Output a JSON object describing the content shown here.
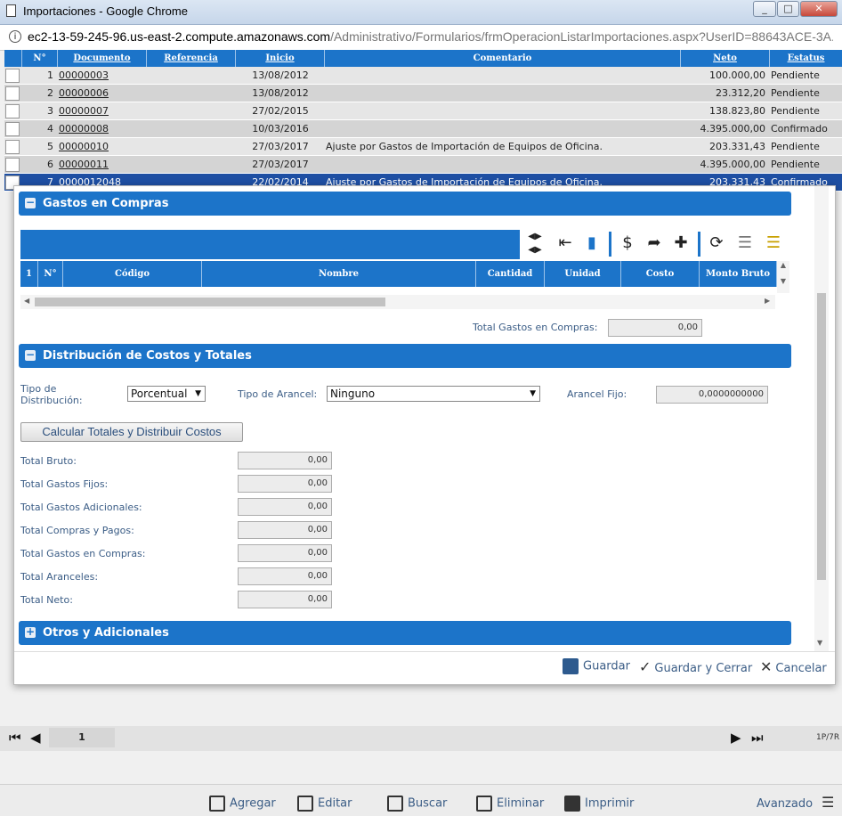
{
  "window": {
    "title": "Importaciones - Google Chrome",
    "min": "_",
    "max": "□",
    "close": "✕"
  },
  "address": {
    "host": "ec2-13-59-245-96.us-east-2.compute.amazonaws.com",
    "path": "/Administrativo/Formularios/frmOperacionListarImportaciones.aspx?UserID=88643ACE-3A..."
  },
  "grid": {
    "headers": {
      "num": "N°",
      "documento": "Documento",
      "referencia": "Referencia",
      "inicio": "Inicio",
      "comentario": "Comentario",
      "neto": "Neto",
      "estatus": "Estatus"
    },
    "rows": [
      {
        "n": "1",
        "doc": "00000003",
        "ref": "",
        "inicio": "13/08/2012",
        "comentario": "",
        "neto": "100.000,00",
        "estatus": "Pendiente"
      },
      {
        "n": "2",
        "doc": "00000006",
        "ref": "",
        "inicio": "13/08/2012",
        "comentario": "",
        "neto": "23.312,20",
        "estatus": "Pendiente"
      },
      {
        "n": "3",
        "doc": "00000007",
        "ref": "",
        "inicio": "27/02/2015",
        "comentario": "",
        "neto": "138.823,80",
        "estatus": "Pendiente"
      },
      {
        "n": "4",
        "doc": "00000008",
        "ref": "",
        "inicio": "10/03/2016",
        "comentario": "",
        "neto": "4.395.000,00",
        "estatus": "Confirmado"
      },
      {
        "n": "5",
        "doc": "00000010",
        "ref": "",
        "inicio": "27/03/2017",
        "comentario": "Ajuste por Gastos de Importación de Equipos de Oficina.",
        "neto": "203.331,43",
        "estatus": "Pendiente"
      },
      {
        "n": "6",
        "doc": "00000011",
        "ref": "",
        "inicio": "27/03/2017",
        "comentario": "",
        "neto": "4.395.000,00",
        "estatus": "Pendiente"
      },
      {
        "n": "7",
        "doc": "0000012048",
        "ref": "",
        "inicio": "22/02/2014",
        "comentario": "Ajuste por Gastos de Importación de Equipos de Oficina.",
        "neto": "203.331,43",
        "estatus": "Confirmado"
      }
    ]
  },
  "modal": {
    "gastos": {
      "title": "Gastos en Compras",
      "toggle": "−",
      "columns": [
        "1",
        "N°",
        "Código",
        "Nombre",
        "Cantidad",
        "Unidad",
        "Costo",
        "Monto Bruto"
      ],
      "total_label": "Total Gastos en Compras:",
      "total_value": "0,00"
    },
    "distribucion": {
      "title": "Distribución de Costos y Totales",
      "toggle": "−",
      "tipo_dist_label": "Tipo de Distribución:",
      "tipo_dist_value": "Porcentual",
      "tipo_arancel_label": "Tipo de Arancel:",
      "tipo_arancel_value": "Ninguno",
      "arancel_fijo_label": "Arancel Fijo:",
      "arancel_fijo_value": "0,0000000000",
      "calc_button": "Calcular Totales y Distribuir Costos",
      "totals": [
        {
          "label": "Total Bruto:",
          "value": "0,00"
        },
        {
          "label": "Total Gastos Fijos:",
          "value": "0,00"
        },
        {
          "label": "Total Gastos Adicionales:",
          "value": "0,00"
        },
        {
          "label": "Total Compras y Pagos:",
          "value": "0,00"
        },
        {
          "label": "Total Gastos en Compras:",
          "value": "0,00"
        },
        {
          "label": "Total Aranceles:",
          "value": "0,00"
        },
        {
          "label": "Total Neto:",
          "value": "0,00"
        }
      ]
    },
    "otros": {
      "title": "Otros y Adicionales",
      "toggle": "+"
    },
    "actions": {
      "guardar": "Guardar",
      "guardar_cerrar": "Guardar y Cerrar",
      "cancelar": "Cancelar"
    }
  },
  "pager": {
    "page": "1",
    "info": "1P/7R"
  },
  "footer": {
    "agregar": "Agregar",
    "editar": "Editar",
    "buscar": "Buscar",
    "eliminar": "Eliminar",
    "imprimir": "Imprimir",
    "avanzado": "Avanzado"
  },
  "colors": {
    "accent": "#1c74c9",
    "selected": "#1e4fa3"
  }
}
